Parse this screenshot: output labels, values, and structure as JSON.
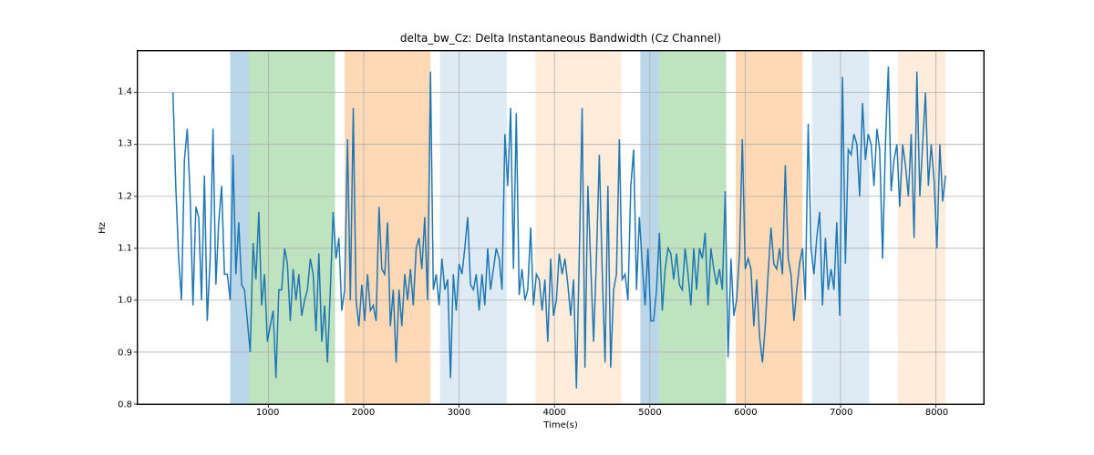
{
  "chart_data": {
    "type": "line",
    "title": "delta_bw_Cz: Delta Instantaneous Bandwidth (Cz Channel)",
    "xlabel": "Time(s)",
    "ylabel": "Hz",
    "xlim": [
      -370,
      8500
    ],
    "ylim": [
      0.8,
      1.48
    ],
    "xticks": [
      1000,
      2000,
      3000,
      4000,
      5000,
      6000,
      7000,
      8000
    ],
    "yticks": [
      0.8,
      0.9,
      1.0,
      1.1,
      1.2,
      1.3,
      1.4
    ],
    "bands": [
      {
        "x0": 600,
        "x1": 800,
        "fill": "#1f77b4",
        "alpha": 0.3
      },
      {
        "x0": 800,
        "x1": 1700,
        "fill": "#2ca02c",
        "alpha": 0.3
      },
      {
        "x0": 1800,
        "x1": 2700,
        "fill": "#ff7f0e",
        "alpha": 0.3
      },
      {
        "x0": 2800,
        "x1": 3500,
        "fill": "#1f77b4",
        "alpha": 0.15
      },
      {
        "x0": 3800,
        "x1": 4700,
        "fill": "#ff7f0e",
        "alpha": 0.15
      },
      {
        "x0": 4900,
        "x1": 5100,
        "fill": "#1f77b4",
        "alpha": 0.3
      },
      {
        "x0": 5100,
        "x1": 5800,
        "fill": "#2ca02c",
        "alpha": 0.3
      },
      {
        "x0": 5900,
        "x1": 6600,
        "fill": "#ff7f0e",
        "alpha": 0.3
      },
      {
        "x0": 6700,
        "x1": 7300,
        "fill": "#1f77b4",
        "alpha": 0.15
      },
      {
        "x0": 7600,
        "x1": 8100,
        "fill": "#ff7f0e",
        "alpha": 0.15
      }
    ],
    "series": [
      {
        "name": "delta_bw_Cz",
        "color": "#1f77b4",
        "x_start": 0,
        "x_step": 30,
        "y": [
          1.4,
          1.22,
          1.08,
          1.0,
          1.27,
          1.33,
          1.2,
          0.99,
          1.18,
          1.16,
          1.0,
          1.24,
          0.96,
          1.08,
          1.33,
          1.03,
          1.15,
          1.22,
          1.05,
          1.05,
          1.0,
          1.28,
          1.05,
          1.15,
          1.03,
          1.02,
          0.96,
          0.9,
          1.11,
          1.04,
          1.17,
          0.99,
          1.05,
          0.92,
          0.95,
          0.98,
          0.85,
          1.02,
          1.02,
          1.1,
          1.07,
          0.96,
          1.06,
          1.0,
          1.05,
          0.97,
          1.0,
          1.02,
          1.08,
          1.05,
          0.94,
          1.09,
          0.92,
          0.99,
          0.88,
          1.02,
          1.17,
          1.08,
          1.12,
          0.98,
          1.02,
          1.31,
          1.0,
          1.37,
          1.0,
          0.95,
          1.03,
          0.96,
          1.05,
          0.98,
          0.99,
          0.96,
          1.18,
          1.06,
          1.05,
          1.15,
          0.95,
          1.02,
          0.88,
          1.02,
          0.95,
          1.05,
          1.0,
          1.06,
          0.99,
          1.1,
          1.12,
          1.06,
          1.16,
          1.0,
          1.44,
          1.02,
          1.05,
          0.99,
          1.08,
          1.02,
          1.04,
          0.85,
          1.05,
          0.98,
          1.07,
          1.05,
          1.1,
          1.16,
          1.03,
          1.02,
          1.05,
          0.98,
          1.05,
          0.99,
          1.1,
          1.02,
          1.06,
          1.1,
          1.08,
          1.02,
          1.32,
          1.22,
          1.37,
          1.06,
          1.36,
          1.01,
          1.06,
          1.0,
          1.02,
          1.14,
          0.99,
          1.05,
          1.04,
          0.98,
          1.04,
          0.92,
          1.08,
          0.97,
          1.0,
          1.09,
          1.05,
          1.08,
          1.03,
          0.97,
          1.04,
          0.83,
          1.08,
          1.37,
          0.87,
          1.22,
          1.07,
          0.92,
          1.08,
          1.28,
          1.06,
          0.88,
          1.22,
          0.87,
          1.02,
          1.05,
          1.31,
          1.04,
          1.05,
          1.0,
          1.22,
          1.29,
          1.02,
          1.16,
          1.07,
          0.99,
          1.1,
          0.96,
          0.96,
          1.02,
          1.13,
          0.98,
          1.06,
          1.1,
          1.09,
          1.04,
          1.09,
          1.03,
          1.02,
          1.1,
          1.05,
          0.99,
          1.1,
          1.02,
          1.1,
          1.08,
          1.13,
          0.99,
          1.1,
          1.06,
          1.03,
          1.06,
          1.02,
          1.21,
          0.89,
          1.08,
          0.97,
          1.0,
          1.09,
          1.31,
          1.06,
          1.08,
          1.06,
          0.95,
          1.04,
          0.93,
          0.88,
          0.95,
          1.05,
          1.14,
          1.07,
          1.06,
          1.1,
          1.05,
          1.26,
          1.08,
          1.05,
          0.96,
          1.02,
          1.07,
          1.1,
          1.0,
          1.34,
          1.1,
          1.05,
          1.12,
          1.17,
          0.99,
          1.12,
          1.02,
          1.06,
          1.02,
          1.15,
          0.97,
          1.43,
          1.07,
          1.29,
          1.28,
          1.32,
          1.3,
          1.2,
          1.38,
          1.27,
          1.32,
          1.3,
          1.22,
          1.33,
          1.29,
          1.08,
          1.3,
          1.45,
          1.21,
          1.27,
          1.3,
          1.18,
          1.3,
          1.26,
          1.2,
          1.32,
          1.12,
          1.44,
          1.2,
          1.3,
          1.4,
          1.22,
          1.3,
          1.23,
          1.1,
          1.3,
          1.19,
          1.24
        ]
      }
    ]
  }
}
